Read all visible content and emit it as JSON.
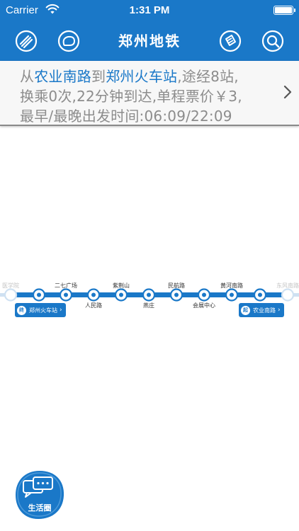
{
  "status_bar": {
    "carrier": "Carrier",
    "time": "1:31 PM"
  },
  "nav": {
    "title": "郑州地铁"
  },
  "route": {
    "line1": {
      "from_prefix": "从",
      "from": "农业南路",
      "to_prefix": "到",
      "to": "郑州火车站",
      "suffix": ",途经8站,"
    },
    "line2": "换乘0次,22分钟到达,单程票价￥3,",
    "line3": "最早/最晚出发时间:06:09/22:09"
  },
  "map": {
    "stations": [
      {
        "name": "医学院",
        "faded": true
      },
      {
        "name": "二七广场",
        "faded": false
      },
      {
        "name": "人民路",
        "faded": false
      },
      {
        "name": "紫荆山",
        "faded": false
      },
      {
        "name": "燕庄",
        "faded": false
      },
      {
        "name": "民航路",
        "faded": false
      },
      {
        "name": "会展中心",
        "faded": false
      },
      {
        "name": "黄河南路",
        "faded": false
      },
      {
        "name": "东风南路",
        "faded": true
      }
    ],
    "start_tag": {
      "badge": "起",
      "label": "农业南路"
    },
    "end_tag": {
      "badge": "终",
      "label": "郑州火车站"
    },
    "line_color": "#1a78c8"
  },
  "life_button": {
    "label": "生活圈"
  },
  "colors": {
    "brand": "#1a78c8",
    "text_gray": "#8c8c8c"
  }
}
